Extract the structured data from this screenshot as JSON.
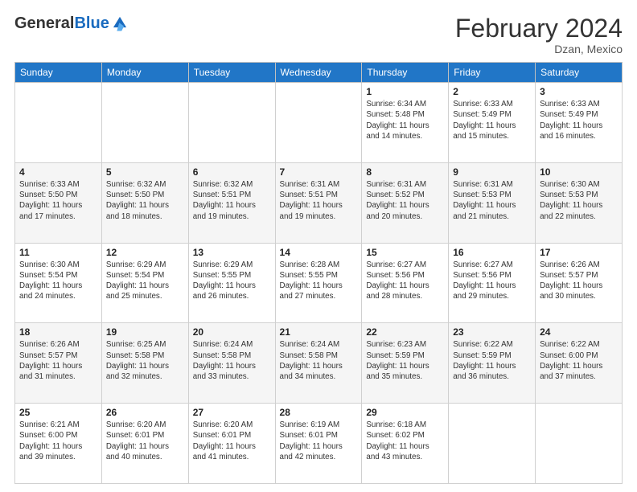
{
  "header": {
    "logo_general": "General",
    "logo_blue": "Blue",
    "month_year": "February 2024",
    "location": "Dzan, Mexico"
  },
  "days_of_week": [
    "Sunday",
    "Monday",
    "Tuesday",
    "Wednesday",
    "Thursday",
    "Friday",
    "Saturday"
  ],
  "weeks": [
    [
      {
        "day": "",
        "info": ""
      },
      {
        "day": "",
        "info": ""
      },
      {
        "day": "",
        "info": ""
      },
      {
        "day": "",
        "info": ""
      },
      {
        "day": "1",
        "info": "Sunrise: 6:34 AM\nSunset: 5:48 PM\nDaylight: 11 hours and 14 minutes."
      },
      {
        "day": "2",
        "info": "Sunrise: 6:33 AM\nSunset: 5:49 PM\nDaylight: 11 hours and 15 minutes."
      },
      {
        "day": "3",
        "info": "Sunrise: 6:33 AM\nSunset: 5:49 PM\nDaylight: 11 hours and 16 minutes."
      }
    ],
    [
      {
        "day": "4",
        "info": "Sunrise: 6:33 AM\nSunset: 5:50 PM\nDaylight: 11 hours and 17 minutes."
      },
      {
        "day": "5",
        "info": "Sunrise: 6:32 AM\nSunset: 5:50 PM\nDaylight: 11 hours and 18 minutes."
      },
      {
        "day": "6",
        "info": "Sunrise: 6:32 AM\nSunset: 5:51 PM\nDaylight: 11 hours and 19 minutes."
      },
      {
        "day": "7",
        "info": "Sunrise: 6:31 AM\nSunset: 5:51 PM\nDaylight: 11 hours and 19 minutes."
      },
      {
        "day": "8",
        "info": "Sunrise: 6:31 AM\nSunset: 5:52 PM\nDaylight: 11 hours and 20 minutes."
      },
      {
        "day": "9",
        "info": "Sunrise: 6:31 AM\nSunset: 5:53 PM\nDaylight: 11 hours and 21 minutes."
      },
      {
        "day": "10",
        "info": "Sunrise: 6:30 AM\nSunset: 5:53 PM\nDaylight: 11 hours and 22 minutes."
      }
    ],
    [
      {
        "day": "11",
        "info": "Sunrise: 6:30 AM\nSunset: 5:54 PM\nDaylight: 11 hours and 24 minutes."
      },
      {
        "day": "12",
        "info": "Sunrise: 6:29 AM\nSunset: 5:54 PM\nDaylight: 11 hours and 25 minutes."
      },
      {
        "day": "13",
        "info": "Sunrise: 6:29 AM\nSunset: 5:55 PM\nDaylight: 11 hours and 26 minutes."
      },
      {
        "day": "14",
        "info": "Sunrise: 6:28 AM\nSunset: 5:55 PM\nDaylight: 11 hours and 27 minutes."
      },
      {
        "day": "15",
        "info": "Sunrise: 6:27 AM\nSunset: 5:56 PM\nDaylight: 11 hours and 28 minutes."
      },
      {
        "day": "16",
        "info": "Sunrise: 6:27 AM\nSunset: 5:56 PM\nDaylight: 11 hours and 29 minutes."
      },
      {
        "day": "17",
        "info": "Sunrise: 6:26 AM\nSunset: 5:57 PM\nDaylight: 11 hours and 30 minutes."
      }
    ],
    [
      {
        "day": "18",
        "info": "Sunrise: 6:26 AM\nSunset: 5:57 PM\nDaylight: 11 hours and 31 minutes."
      },
      {
        "day": "19",
        "info": "Sunrise: 6:25 AM\nSunset: 5:58 PM\nDaylight: 11 hours and 32 minutes."
      },
      {
        "day": "20",
        "info": "Sunrise: 6:24 AM\nSunset: 5:58 PM\nDaylight: 11 hours and 33 minutes."
      },
      {
        "day": "21",
        "info": "Sunrise: 6:24 AM\nSunset: 5:58 PM\nDaylight: 11 hours and 34 minutes."
      },
      {
        "day": "22",
        "info": "Sunrise: 6:23 AM\nSunset: 5:59 PM\nDaylight: 11 hours and 35 minutes."
      },
      {
        "day": "23",
        "info": "Sunrise: 6:22 AM\nSunset: 5:59 PM\nDaylight: 11 hours and 36 minutes."
      },
      {
        "day": "24",
        "info": "Sunrise: 6:22 AM\nSunset: 6:00 PM\nDaylight: 11 hours and 37 minutes."
      }
    ],
    [
      {
        "day": "25",
        "info": "Sunrise: 6:21 AM\nSunset: 6:00 PM\nDaylight: 11 hours and 39 minutes."
      },
      {
        "day": "26",
        "info": "Sunrise: 6:20 AM\nSunset: 6:01 PM\nDaylight: 11 hours and 40 minutes."
      },
      {
        "day": "27",
        "info": "Sunrise: 6:20 AM\nSunset: 6:01 PM\nDaylight: 11 hours and 41 minutes."
      },
      {
        "day": "28",
        "info": "Sunrise: 6:19 AM\nSunset: 6:01 PM\nDaylight: 11 hours and 42 minutes."
      },
      {
        "day": "29",
        "info": "Sunrise: 6:18 AM\nSunset: 6:02 PM\nDaylight: 11 hours and 43 minutes."
      },
      {
        "day": "",
        "info": ""
      },
      {
        "day": "",
        "info": ""
      }
    ]
  ]
}
